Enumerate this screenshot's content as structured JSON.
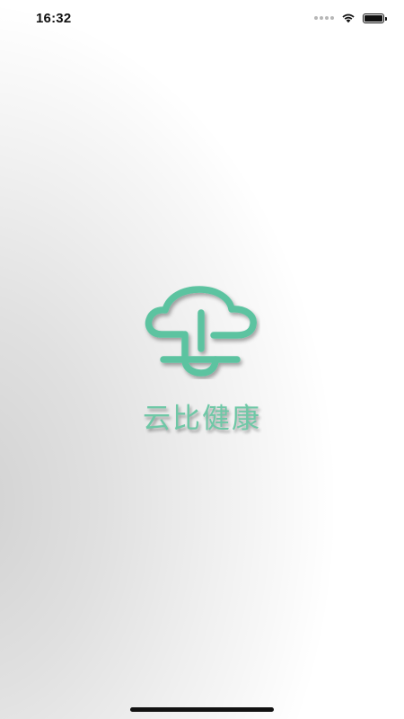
{
  "status_bar": {
    "time": "16:32",
    "battery_level": 1.0
  },
  "splash": {
    "app_name": "云比健康",
    "logo_icon": "cloud-plus-icon",
    "brand_color": "#5cc3a0"
  },
  "icons": {
    "signal": "cellular-signal-icon",
    "wifi": "wifi-icon",
    "battery": "battery-icon"
  }
}
